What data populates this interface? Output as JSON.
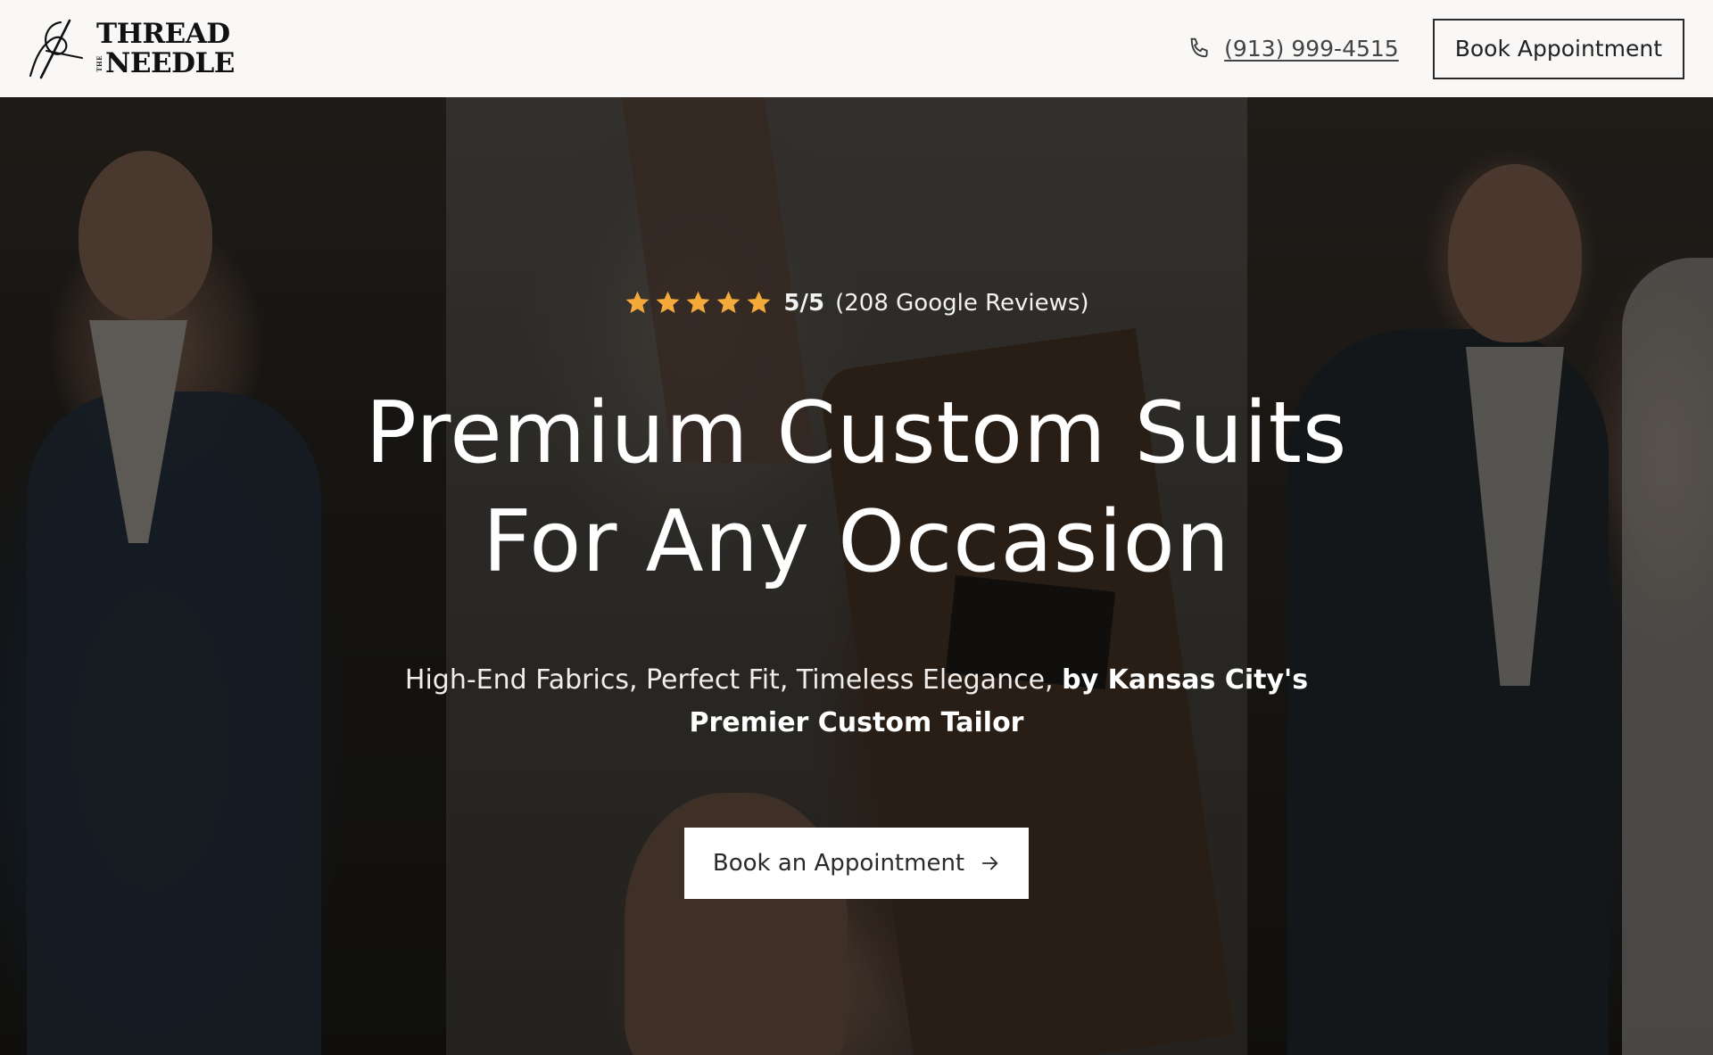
{
  "header": {
    "logo": {
      "line1": "THREAD",
      "small": "THE",
      "line2": "NEEDLE"
    },
    "phone": "(913) 999-4515",
    "book_button": "Book Appointment"
  },
  "hero": {
    "rating": {
      "stars": 5,
      "score": "5/5",
      "reviews": "(208 Google Reviews)",
      "star_color": "#f4a93b"
    },
    "title_line1": "Premium Custom Suits",
    "title_line2": "For Any Occasion",
    "subtitle_regular": "High-End Fabrics, Perfect Fit, Timeless Elegance,",
    "subtitle_bold": "by Kansas City's Premier Custom Tailor",
    "cta_label": "Book an Appointment"
  },
  "icons": {
    "logo_mark": "needle-thread-icon",
    "phone": "phone-icon",
    "star": "star-icon",
    "cta": "arrow-right-icon"
  }
}
